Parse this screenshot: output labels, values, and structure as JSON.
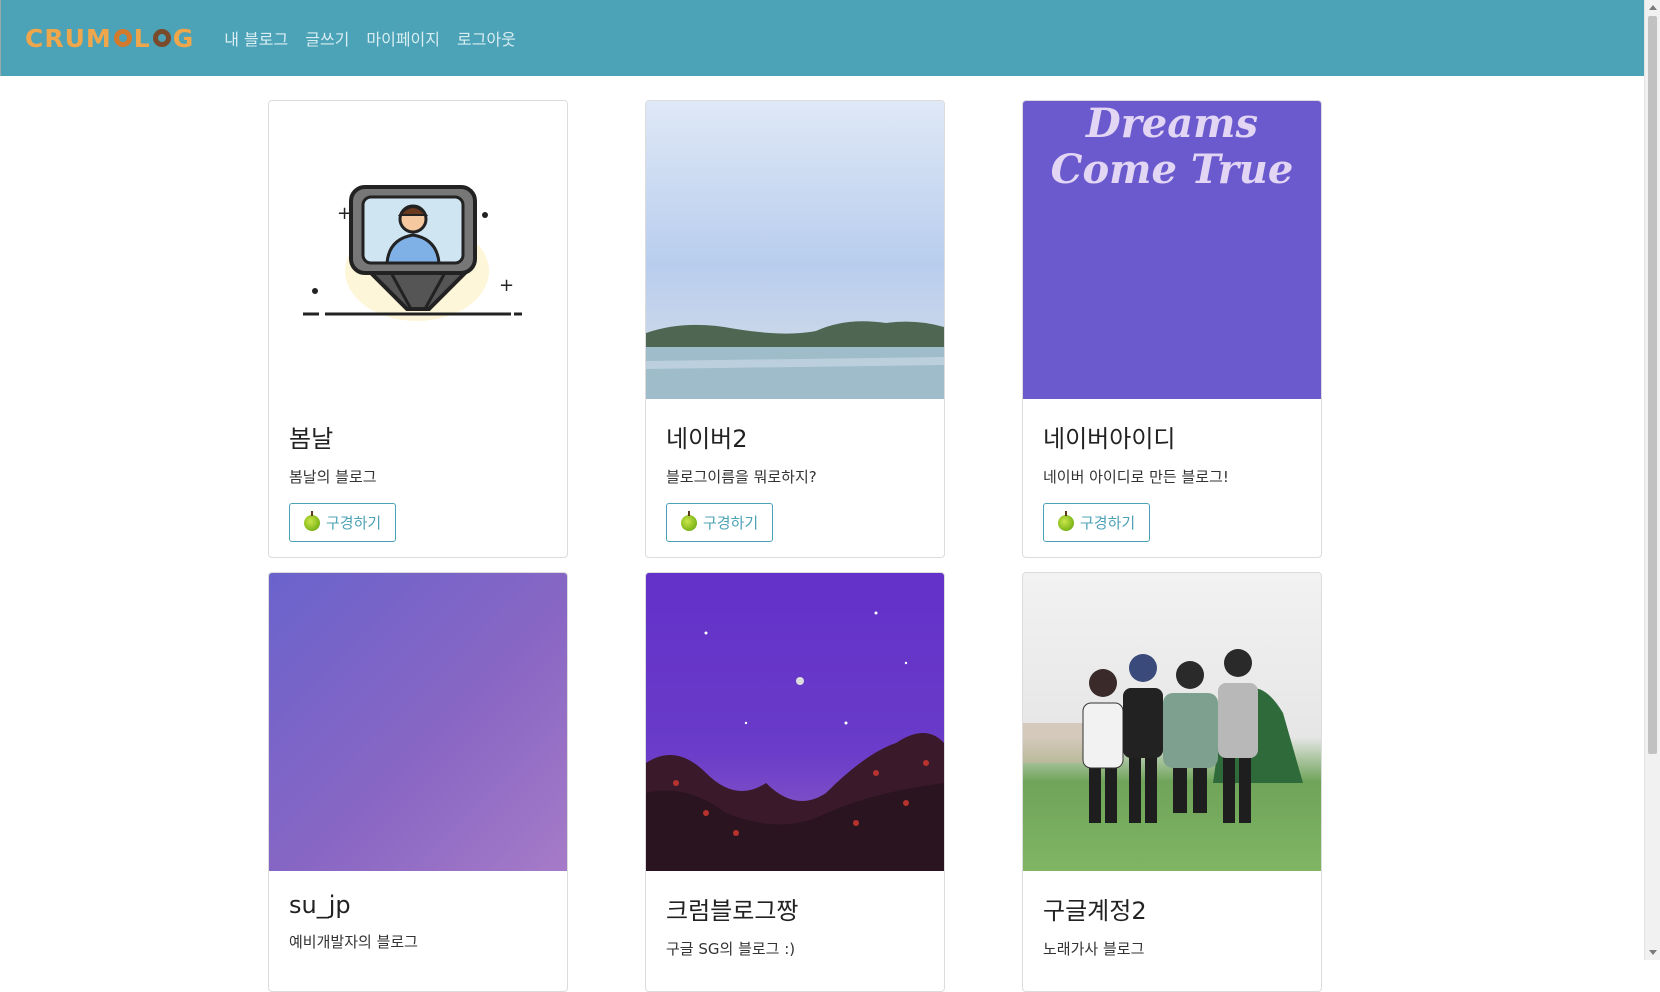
{
  "navbar": {
    "brand": "CRUMBLOG",
    "links": [
      "내 블로그",
      "글쓰기",
      "마이페이지",
      "로그아웃"
    ]
  },
  "cards": [
    {
      "title": "봄날",
      "description": "봄날의 블로그",
      "button": "구경하기",
      "image": "camera-person-illustration"
    },
    {
      "title": "네이버2",
      "description": "블로그이름을 뭐로하지?",
      "button": "구경하기",
      "image": "sea-landscape"
    },
    {
      "title": "네이버아이디",
      "description": "네이버 아이디로 만든 블로그!",
      "button": "구경하기",
      "image": "dreams-come-true",
      "image_text": "Dreams Come True"
    },
    {
      "title": "su_jp",
      "description": "예비개발자의 블로그",
      "image": "purple-gradient"
    },
    {
      "title": "크럼블로그짱",
      "description": "구글 SG의 블로그 :)",
      "image": "night-sky"
    },
    {
      "title": "구글계정2",
      "description": "노래가사 블로그",
      "image": "friends-illustration"
    }
  ],
  "colors": {
    "navbar": "#4ca2b6",
    "brand": "#f0a64b",
    "button_border": "#4ca2b6"
  }
}
